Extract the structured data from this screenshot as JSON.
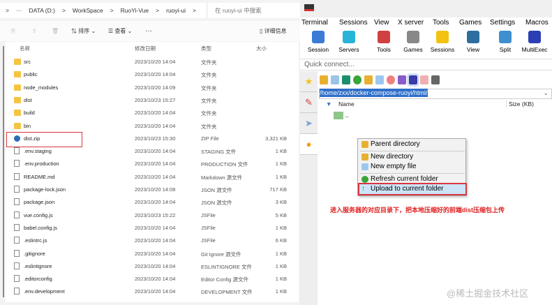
{
  "explorer": {
    "breadcrumb": [
      ">",
      "···",
      "DATA (D:)",
      ">",
      "WorkSpace",
      ">",
      "RuoYi-Vue",
      ">",
      "ruoyi-ui",
      ">"
    ],
    "search_placeholder": "在 ruoyi-ui 中搜索",
    "toolbar": {
      "sort": "排序",
      "view": "查看",
      "more": "···",
      "details": "详细信息"
    },
    "columns": {
      "name": "名称",
      "date": "修改日期",
      "type": "类型",
      "size": "大小"
    },
    "files": [
      {
        "name": "src",
        "date": "2023/10/20 14:04",
        "type": "文件夹",
        "size": "",
        "icon": "folder"
      },
      {
        "name": "public",
        "date": "2023/10/20 14:04",
        "type": "文件夹",
        "size": "",
        "icon": "folder"
      },
      {
        "name": "node_modules",
        "date": "2023/10/20 14:09",
        "type": "文件夹",
        "size": "",
        "icon": "folder"
      },
      {
        "name": "dist",
        "date": "2023/10/23 15:27",
        "type": "文件夹",
        "size": "",
        "icon": "folder"
      },
      {
        "name": "build",
        "date": "2023/10/20 14:04",
        "type": "文件夹",
        "size": "",
        "icon": "folder"
      },
      {
        "name": "bin",
        "date": "2023/10/20 14:04",
        "type": "文件夹",
        "size": "",
        "icon": "folder"
      },
      {
        "name": "dist.zip",
        "date": "2023/10/23 15:30",
        "type": "ZIP File",
        "size": "3,321 KB",
        "icon": "zip"
      },
      {
        "name": ".env.staging",
        "date": "2023/10/20 14:04",
        "type": "STAGING 文件",
        "size": "1 KB",
        "icon": "file"
      },
      {
        "name": ".env.production",
        "date": "2023/10/20 14:04",
        "type": "PRODUCTION 文件",
        "size": "1 KB",
        "icon": "file"
      },
      {
        "name": "README.md",
        "date": "2023/10/20 14:04",
        "type": "Markdown 源文件",
        "size": "1 KB",
        "icon": "file"
      },
      {
        "name": "package-lock.json",
        "date": "2023/10/20 14:08",
        "type": "JSON 源文件",
        "size": "717 KB",
        "icon": "file"
      },
      {
        "name": "package.json",
        "date": "2023/10/20 14:04",
        "type": "JSON 源文件",
        "size": "3 KB",
        "icon": "file"
      },
      {
        "name": "vue.config.js",
        "date": "2023/10/23 15:22",
        "type": "JSFile",
        "size": "5 KB",
        "icon": "file"
      },
      {
        "name": "babel.config.js",
        "date": "2023/10/20 14:04",
        "type": "JSFile",
        "size": "1 KB",
        "icon": "file"
      },
      {
        "name": ".eslintrc.js",
        "date": "2023/10/20 14:04",
        "type": "JSFile",
        "size": "6 KB",
        "icon": "file"
      },
      {
        "name": ".gitignore",
        "date": "2023/10/20 14:04",
        "type": "Git Ignore 源文件",
        "size": "1 KB",
        "icon": "file"
      },
      {
        "name": ".eslintignore",
        "date": "2023/10/20 14:04",
        "type": "ESLINTIGNORE 文件",
        "size": "1 KB",
        "icon": "file"
      },
      {
        "name": ".editorconfig",
        "date": "2023/10/20 14:04",
        "type": "Editor Config 源文件",
        "size": "1 KB",
        "icon": "file"
      },
      {
        "name": ".env.development",
        "date": "2023/10/20 14:04",
        "type": "DEVELOPMENT 文件",
        "size": "1 KB",
        "icon": "file"
      }
    ]
  },
  "moba": {
    "menu": [
      "Terminal",
      "Sessions",
      "View",
      "X server",
      "Tools",
      "Games",
      "Settings",
      "Macros"
    ],
    "tools": [
      {
        "label": "Session",
        "color": "#3a7bd5"
      },
      {
        "label": "Servers",
        "color": "#28b4d8"
      },
      {
        "label": "Tools",
        "color": "#d04040"
      },
      {
        "label": "Games",
        "color": "#888888"
      },
      {
        "label": "Sessions",
        "color": "#f2c20f"
      },
      {
        "label": "View",
        "color": "#2e6e9e"
      },
      {
        "label": "Split",
        "color": "#3f8fd0"
      },
      {
        "label": "MultiExec",
        "color": "#2d3fb5"
      }
    ],
    "quick_connect": "Quick connect...",
    "path": "/home/zxx/docker-compose-ruoyi/html/",
    "columns": {
      "name": "Name",
      "size": "Size (KB)"
    },
    "parent_entry": "..",
    "context_menu": [
      "Parent directory",
      "New directory",
      "New empty file",
      "Refresh current folder",
      "Upload to current folder"
    ],
    "annotation": "进入服务器的对应目录下，把本地压缩好的前端dist压缩包上传"
  },
  "watermark": "@稀土掘金技术社区",
  "colors": {
    "highlight_border": "#d9363e",
    "selection": "#2f6fc9",
    "annotation": "#e02020"
  }
}
